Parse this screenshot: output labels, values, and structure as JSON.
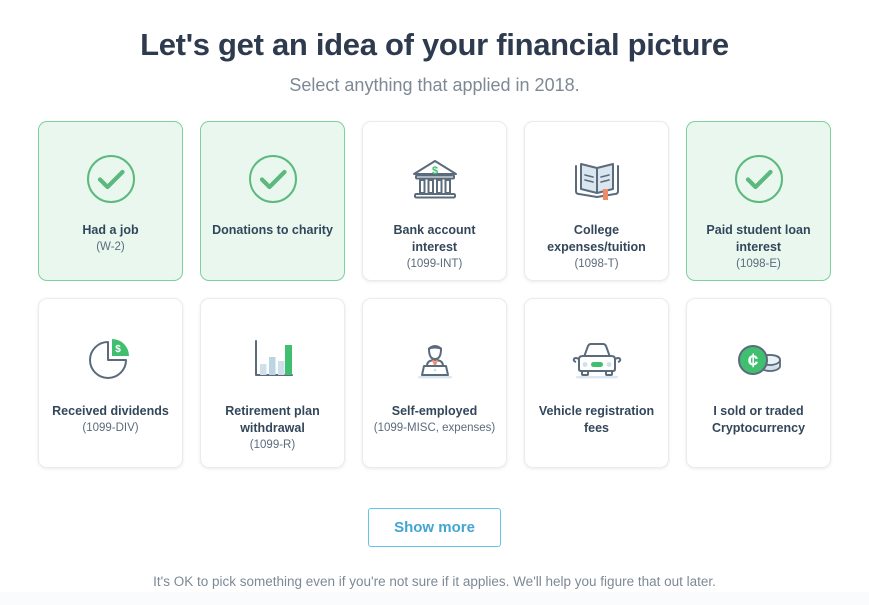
{
  "header": {
    "title": "Let's get an idea of your financial picture",
    "subtitle": "Select anything that applied in 2018."
  },
  "colors": {
    "selected_background": "#e9f7ee",
    "selected_border": "#7fd09b",
    "check_green": "#4fb574",
    "accent_green": "#3fbf6f",
    "icon_gray": "#5b6b7c",
    "icon_blue": "#cfe0ea",
    "icon_orange": "#ef8b66",
    "button_border": "#66c3e8",
    "button_text": "#42a5d3",
    "title_text": "#2e3b4e",
    "muted_text": "#7d8995"
  },
  "cards": {
    "row1": [
      {
        "id": "had-a-job",
        "icon": "check-circle-icon",
        "title": "Had a job",
        "sub": "(W-2)",
        "selected": true
      },
      {
        "id": "donations-to-charity",
        "icon": "check-circle-icon",
        "title": "Donations to charity",
        "sub": "",
        "selected": true
      },
      {
        "id": "bank-account-interest",
        "icon": "bank-building-icon",
        "title": "Bank account interest",
        "sub": "(1099-INT)",
        "selected": false
      },
      {
        "id": "college-expenses-tuition",
        "icon": "open-book-icon",
        "title": "College expenses/tuition",
        "sub": "(1098-T)",
        "selected": false
      },
      {
        "id": "paid-student-loan-interest",
        "icon": "check-circle-icon",
        "title": "Paid student loan interest",
        "sub": "(1098-E)",
        "selected": true
      }
    ],
    "row2": [
      {
        "id": "received-dividends",
        "icon": "pie-chart-dollar-icon",
        "title": "Received dividends",
        "sub": "(1099-DIV)",
        "selected": false
      },
      {
        "id": "retirement-plan-withdrawal",
        "icon": "bar-chart-icon",
        "title": "Retirement plan withdrawal",
        "sub": "(1099-R)",
        "selected": false
      },
      {
        "id": "self-employed",
        "icon": "person-laptop-icon",
        "title": "Self-employed",
        "sub": "(1099-MISC, expenses)",
        "selected": false
      },
      {
        "id": "vehicle-registration-fees",
        "icon": "car-icon",
        "title": "Vehicle registration fees",
        "sub": "",
        "selected": false
      },
      {
        "id": "cryptocurrency",
        "icon": "coins-icon",
        "title": "I sold or traded Cryptocurrency",
        "sub": "",
        "selected": false
      }
    ]
  },
  "show_more": {
    "label": "Show more"
  },
  "footer": {
    "note": "It's OK to pick something even if you're not sure if it applies. We'll help you figure that out later."
  }
}
